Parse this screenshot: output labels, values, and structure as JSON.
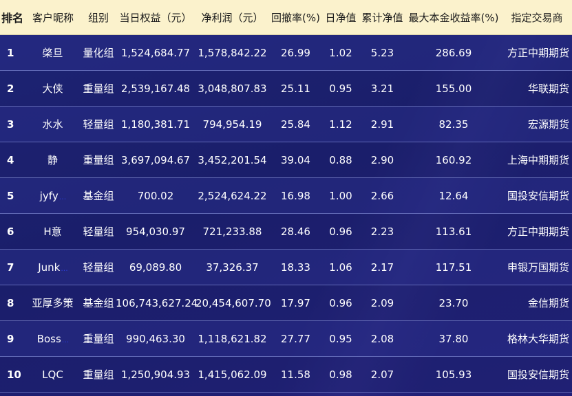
{
  "headers": [
    "排名",
    "客户昵称",
    "组别",
    "当日权益（元）",
    "净利润（元）",
    "回撤率(%)",
    "日净值",
    "累计净值",
    "最大本金收益率(%)",
    "指定交易商"
  ],
  "rows": [
    {
      "rank": "1",
      "name": "棨旦",
      "dots": "",
      "group": "量化组",
      "equity": "1,524,684.77",
      "profit": "1,578,842.22",
      "drawdown": "26.99",
      "daily_nav": "1.02",
      "cum_nav": "5.23",
      "max_return": "286.69",
      "broker": "方正中期期货"
    },
    {
      "rank": "2",
      "name": "大侠",
      "dots": "",
      "group": "重量组",
      "equity": "2,539,167.48",
      "profit": "3,048,807.83",
      "drawdown": "25.11",
      "daily_nav": "0.95",
      "cum_nav": "3.21",
      "max_return": "155.00",
      "broker": "华联期货"
    },
    {
      "rank": "3",
      "name": "水水",
      "dots": "",
      "group": "轻量组",
      "equity": "1,180,381.71",
      "profit": "794,954.19",
      "drawdown": "25.84",
      "daily_nav": "1.12",
      "cum_nav": "2.91",
      "max_return": "82.35",
      "broker": "宏源期货"
    },
    {
      "rank": "4",
      "name": "静",
      "dots": "",
      "group": "重量组",
      "equity": "3,697,094.67",
      "profit": "3,452,201.54",
      "drawdown": "39.04",
      "daily_nav": "0.88",
      "cum_nav": "2.90",
      "max_return": "160.92",
      "broker": "上海中期期货"
    },
    {
      "rank": "5",
      "name": "jyfy",
      "dots": "...",
      "group": "基金组",
      "equity": "700.02",
      "profit": "2,524,624.22",
      "drawdown": "16.98",
      "daily_nav": "1.00",
      "cum_nav": "2.66",
      "max_return": "12.64",
      "broker": "国投安信期货"
    },
    {
      "rank": "6",
      "name": "H意",
      "dots": "",
      "group": "轻量组",
      "equity": "954,030.97",
      "profit": "721,233.88",
      "drawdown": "28.46",
      "daily_nav": "0.96",
      "cum_nav": "2.23",
      "max_return": "113.61",
      "broker": "方正中期期货"
    },
    {
      "rank": "7",
      "name": "Junk",
      "dots": "...",
      "group": "轻量组",
      "equity": "69,089.80",
      "profit": "37,326.37",
      "drawdown": "18.33",
      "daily_nav": "1.06",
      "cum_nav": "2.17",
      "max_return": "117.51",
      "broker": "申银万国期货"
    },
    {
      "rank": "8",
      "name": "亚厚多策",
      "dots": "",
      "group": "基金组",
      "equity": "106,743,627.24",
      "profit": "20,454,607.70",
      "drawdown": "17.97",
      "daily_nav": "0.96",
      "cum_nav": "2.09",
      "max_return": "23.70",
      "broker": "金信期货"
    },
    {
      "rank": "9",
      "name": "Boss",
      "dots": "...",
      "group": "重量组",
      "equity": "990,463.30",
      "profit": "1,118,621.82",
      "drawdown": "27.77",
      "daily_nav": "0.95",
      "cum_nav": "2.08",
      "max_return": "37.80",
      "broker": "格林大华期货"
    },
    {
      "rank": "10",
      "name": "LQC",
      "dots": "",
      "group": "重量组",
      "equity": "1,250,904.93",
      "profit": "1,415,062.09",
      "drawdown": "11.58",
      "daily_nav": "0.98",
      "cum_nav": "2.07",
      "max_return": "105.93",
      "broker": "国投安信期货"
    }
  ]
}
